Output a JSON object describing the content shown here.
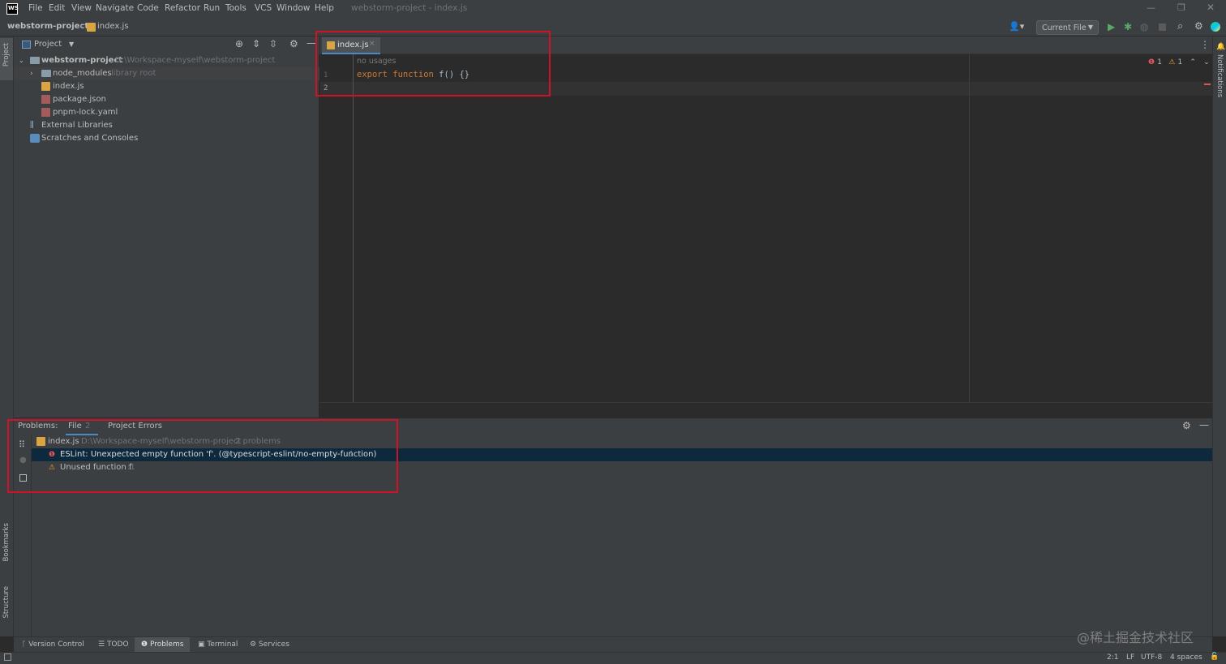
{
  "title_bar": {
    "app_logo": "WS",
    "menu": [
      "File",
      "Edit",
      "View",
      "Navigate",
      "Code",
      "Refactor",
      "Run",
      "Tools",
      "VCS",
      "Window",
      "Help"
    ],
    "window_title": "webstorm-project - index.js"
  },
  "nav_bar": {
    "project": "webstorm-project",
    "file": "index.js",
    "run_config": "Current File"
  },
  "project_panel": {
    "header": "Project",
    "tree": [
      {
        "label": "webstorm-project",
        "hint": "D:\\Workspace-myself\\webstorm-project",
        "icon": "folder-icon"
      },
      {
        "label": "node_modules",
        "hint": "library root",
        "icon": "folder-icon"
      },
      {
        "label": "index.js",
        "hint": "",
        "icon": "js-file-icon"
      },
      {
        "label": "package.json",
        "hint": "",
        "icon": "json-file-icon"
      },
      {
        "label": "pnpm-lock.yaml",
        "hint": "",
        "icon": "yaml-file-icon"
      },
      {
        "label": "External Libraries",
        "hint": "",
        "icon": "library-icon"
      },
      {
        "label": "Scratches and Consoles",
        "hint": "",
        "icon": "scratches-icon"
      }
    ]
  },
  "editor": {
    "tab": "index.js",
    "inlay_hint": "no usages",
    "line_numbers": [
      "1",
      "2"
    ],
    "code": {
      "kw1": "export",
      "kw2": "function",
      "name": "f",
      "rest": "() {}"
    },
    "error_count": "1",
    "warning_count": "1"
  },
  "problems": {
    "label": "Problems:",
    "tabs": [
      {
        "label": "File",
        "count": "2"
      },
      {
        "label": "Project Errors",
        "count": ""
      }
    ],
    "file": {
      "name": "index.js",
      "path": "D:\\Workspace-myself\\webstorm-project",
      "summary": "2 problems"
    },
    "items": [
      {
        "severity": "error",
        "text": "ESLint: Unexpected empty function 'f'. (@typescript-eslint/no-empty-function)",
        "loc": ":1"
      },
      {
        "severity": "warning",
        "text": "Unused function f",
        "loc": ":1"
      }
    ]
  },
  "side_labels": {
    "left_top": "Project",
    "left_bottom1": "Bookmarks",
    "left_bottom2": "Structure",
    "right": "Notifications"
  },
  "bottom_tools": [
    "Version Control",
    "TODO",
    "Problems",
    "Terminal",
    "Services"
  ],
  "status_bar": {
    "position": "2:1",
    "line_sep": "LF",
    "encoding": "UTF-8",
    "indent": "4 spaces"
  },
  "watermark": "@稀土掘金技术社区",
  "colors": {
    "highlight_box": "#d01226",
    "error": "#e05555",
    "warning": "#f0a732",
    "accent": "#4a88c7"
  }
}
